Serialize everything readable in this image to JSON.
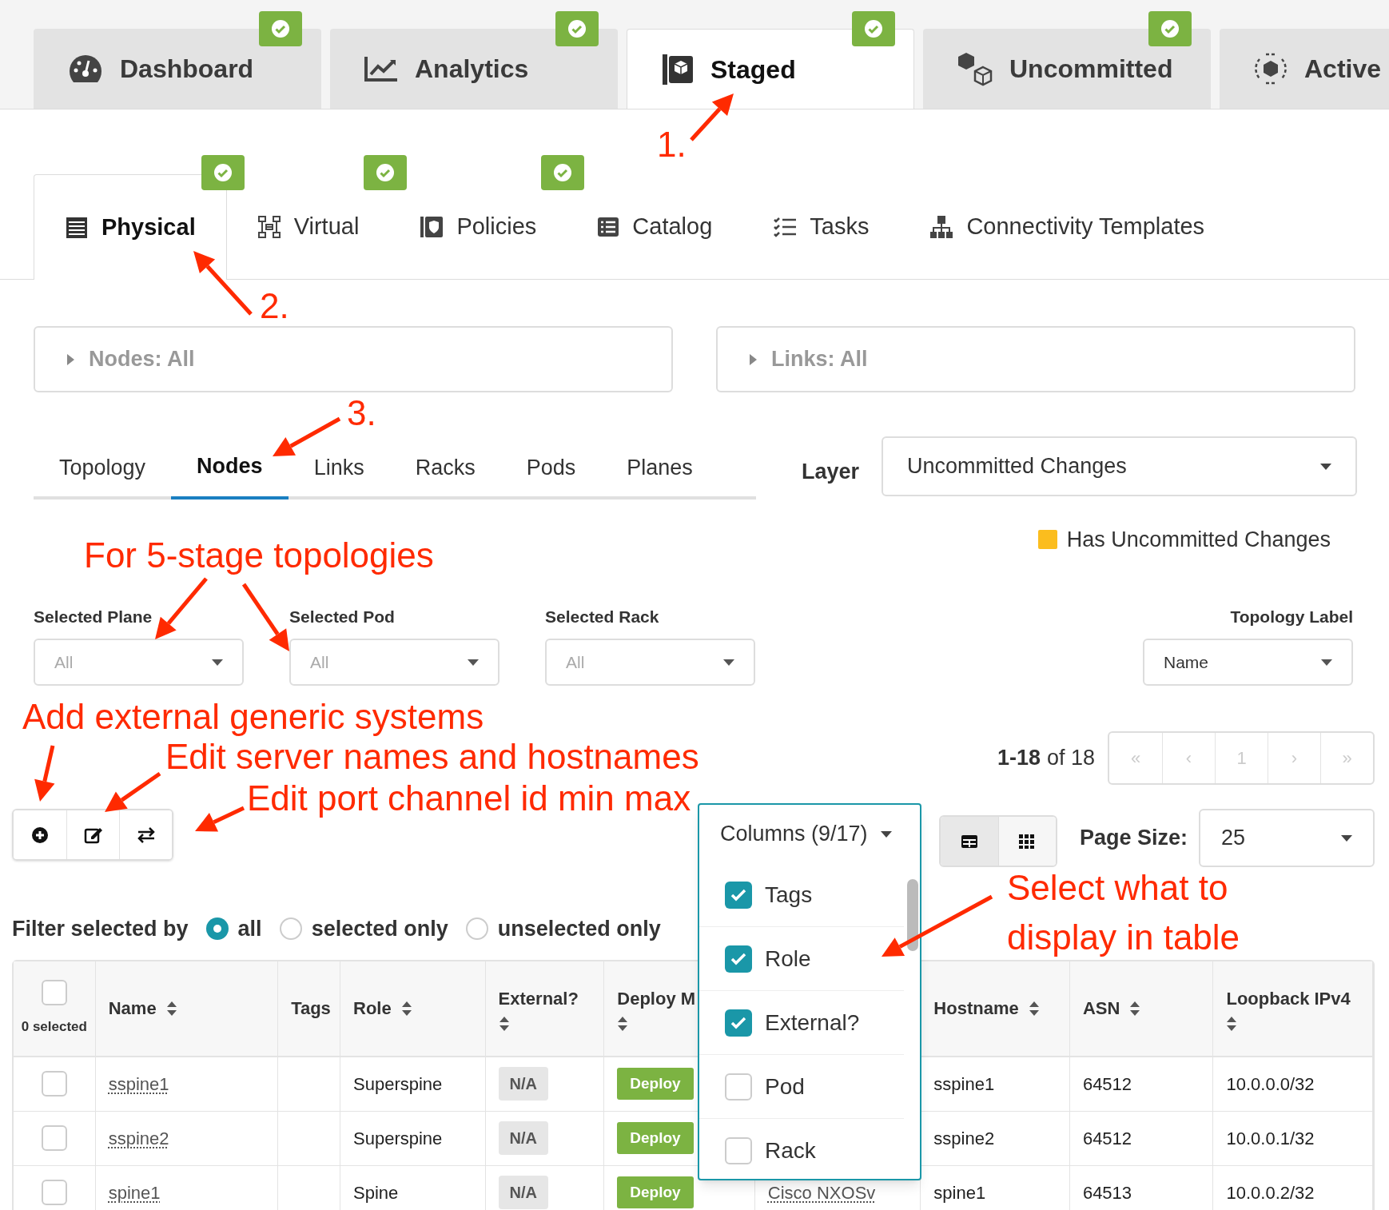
{
  "main_tabs": [
    {
      "label": "Dashboard",
      "selected": false,
      "status_check": true
    },
    {
      "label": "Analytics",
      "selected": false,
      "status_check": true
    },
    {
      "label": "Staged",
      "selected": true,
      "status_check": true
    },
    {
      "label": "Uncommitted",
      "selected": false,
      "status_check": true
    },
    {
      "label": "Active",
      "selected": false
    }
  ],
  "section_tabs": [
    {
      "label": "Physical",
      "selected": true,
      "status_check": true
    },
    {
      "label": "Virtual",
      "selected": false,
      "status_check": true
    },
    {
      "label": "Policies",
      "selected": false,
      "status_check": true
    },
    {
      "label": "Catalog",
      "selected": false,
      "status_check": false
    },
    {
      "label": "Tasks",
      "selected": false,
      "status_check": false
    },
    {
      "label": "Connectivity Templates",
      "selected": false,
      "status_check": false
    }
  ],
  "filters_accordions": [
    {
      "label": "Nodes: All",
      "expanded": false
    },
    {
      "label": "Links: All",
      "expanded": false
    }
  ],
  "view_tabs": [
    {
      "label": "Topology",
      "selected": false
    },
    {
      "label": "Nodes",
      "selected": true
    },
    {
      "label": "Links",
      "selected": false
    },
    {
      "label": "Racks",
      "selected": false
    },
    {
      "label": "Pods",
      "selected": false
    },
    {
      "label": "Planes",
      "selected": false
    }
  ],
  "layer": {
    "label": "Layer",
    "value": "Uncommitted Changes"
  },
  "legend": {
    "label": "Has Uncommitted Changes",
    "color": "#fbbd1e"
  },
  "selectors": [
    {
      "label": "Selected Plane",
      "placeholder": "All"
    },
    {
      "label": "Selected Pod",
      "placeholder": "All"
    },
    {
      "label": "Selected Rack",
      "placeholder": "All"
    }
  ],
  "topology_label": {
    "label": "Topology Label",
    "value": "Name"
  },
  "pagination": {
    "range": "1-18",
    "of": "of 18",
    "buttons": [
      "«",
      "‹",
      "1",
      "›",
      "»"
    ]
  },
  "columns_menu": {
    "label": "Columns (9/17)",
    "items": [
      {
        "label": "Tags",
        "checked": true
      },
      {
        "label": "Role",
        "checked": true
      },
      {
        "label": "External?",
        "checked": true
      },
      {
        "label": "Pod",
        "checked": false
      },
      {
        "label": "Rack",
        "checked": false
      }
    ]
  },
  "view_toggle": [
    {
      "selected": true
    },
    {
      "selected": false
    }
  ],
  "page_size": {
    "label": "Page Size:",
    "value": "25"
  },
  "filter_selected": {
    "label": "Filter selected by",
    "options": [
      {
        "label": "all",
        "selected": true
      },
      {
        "label": "selected only",
        "selected": false
      },
      {
        "label": "unselected only",
        "selected": false
      }
    ]
  },
  "table": {
    "all_checked": false,
    "selected_count": "0 selected",
    "columns": [
      {
        "label": "Name",
        "sortable": true
      },
      {
        "label": "Tags",
        "sortable": false
      },
      {
        "label": "Role",
        "sortable": true
      },
      {
        "label": "External?",
        "sortable": true
      },
      {
        "label": "Deploy M",
        "sortable": true
      },
      {},
      {
        "label": "Hostname",
        "sortable": true
      },
      {
        "label": "ASN",
        "sortable": true
      },
      {
        "label": "Loopback IPv4",
        "sortable": true
      }
    ],
    "rows": [
      {
        "checked": false,
        "name": "sspine1",
        "role": "Superspine",
        "external": "N/A",
        "deploy": "Deploy",
        "hostname": "sspine1",
        "asn": "64512",
        "loopback": "10.0.0.0/32"
      },
      {
        "checked": false,
        "name": "sspine2",
        "role": "Superspine",
        "external": "N/A",
        "deploy": "Deploy",
        "hostname": "sspine2",
        "asn": "64512",
        "loopback": "10.0.0.1/32"
      },
      {
        "checked": false,
        "name": "spine1",
        "role": "Spine",
        "external": "N/A",
        "deploy": "Deploy",
        "column_7": "Cisco NXOSv",
        "hostname": "spine1",
        "asn": "64513",
        "loopback": "10.0.0.2/32"
      }
    ]
  },
  "annotations": [
    {
      "text": "1."
    },
    {
      "text": "2."
    },
    {
      "text": "3."
    },
    {
      "text": "For 5-stage topologies"
    },
    {
      "text": "Add external generic systems"
    },
    {
      "text": "Edit server names and hostnames"
    },
    {
      "text": "Edit port channel id min max"
    },
    {
      "text": "Select what to display in table"
    }
  ]
}
